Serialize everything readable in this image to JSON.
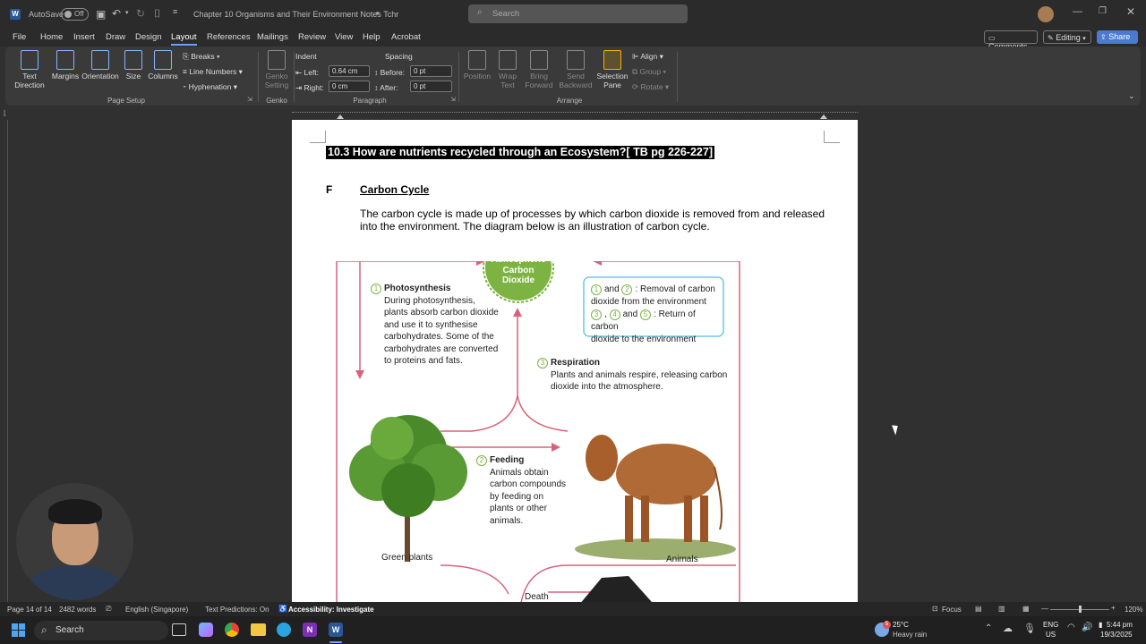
{
  "window": {
    "app_icon": "W",
    "autosave_label": "AutoSave",
    "autosave_state": "Off",
    "doc_title": "Chapter 10 Organisms and Their Environment Notes Tchr",
    "search_placeholder": "Search"
  },
  "menu_tabs": [
    "File",
    "Home",
    "Insert",
    "Draw",
    "Design",
    "Layout",
    "References",
    "Mailings",
    "Review",
    "View",
    "Help",
    "Acrobat"
  ],
  "active_tab": "Layout",
  "top_right": {
    "comments": "Comments",
    "editing": "Editing",
    "share": "Share"
  },
  "ribbon": {
    "page_setup": {
      "text_direction": "Text Direction",
      "margins": "Margins",
      "orientation": "Orientation",
      "size": "Size",
      "columns": "Columns",
      "breaks": "Breaks",
      "line_numbers": "Line Numbers",
      "hyphenation": "Hyphenation",
      "group_label": "Page Setup"
    },
    "genko": {
      "button": "Genko Setting",
      "group_label": "Genko"
    },
    "paragraph": {
      "indent_label": "Indent",
      "spacing_label": "Spacing",
      "left_label": "Left:",
      "left_value": "0.64 cm",
      "right_label": "Right:",
      "right_value": "0 cm",
      "before_label": "Before:",
      "before_value": "0 pt",
      "after_label": "After:",
      "after_value": "0 pt",
      "group_label": "Paragraph"
    },
    "arrange": {
      "position": "Position",
      "wrap_text": "Wrap Text",
      "bring_forward": "Bring Forward",
      "send_backward": "Send Backward",
      "selection_pane": "Selection Pane",
      "align": "Align",
      "group": "Group",
      "rotate": "Rotate",
      "group_label": "Arrange"
    }
  },
  "document": {
    "heading": "10.3 How are nutrients recycled through an Ecosystem?[ TB pg 226-227]",
    "section_letter": "F",
    "section_title": "Carbon Cycle",
    "intro": "The carbon cycle is made up of processes by which carbon dioxide is removed from and released into the environment. The diagram below is an illustration of carbon cycle.",
    "diagram": {
      "atmo_line1": "Atmospheric",
      "atmo_line2": "Carbon",
      "atmo_line3": "Dioxide",
      "photo_num": "1",
      "photo_title": "Photosynthesis",
      "photo_lines": [
        "During photosynthesis,",
        "plants absorb carbon dioxide",
        "and use it to synthesise",
        "carbohydrates. Some of the",
        "carbohydrates are converted",
        "to proteins and fats."
      ],
      "legend_line1": ": Removal of carbon",
      "legend_line2": "dioxide from the environment",
      "legend_line3": ": Return of carbon",
      "legend_line4": "dioxide to the environment",
      "legend_and": "and",
      "legend_comma": ",",
      "legend_nums": [
        "1",
        "2",
        "3",
        "4",
        "5"
      ],
      "resp_num": "3",
      "resp_title": "Respiration",
      "resp_lines": [
        "Plants and animals respire, releasing carbon",
        "dioxide into the atmosphere."
      ],
      "feed_num": "2",
      "feed_title": "Feeding",
      "feed_lines": [
        "Animals obtain",
        "carbon compounds",
        "by feeding on",
        "plants or other",
        "animals."
      ],
      "green_plants": "Green plants",
      "animals": "Animals",
      "death": "Death"
    }
  },
  "status": {
    "page": "Page 14 of 14",
    "words": "2482 words",
    "language": "English (Singapore)",
    "predictions": "Text Predictions: On",
    "accessibility": "Accessibility: Investigate",
    "focus": "Focus",
    "zoom": "120%"
  },
  "taskbar": {
    "search": "Search",
    "weather_temp": "25°C",
    "weather_desc": "Heavy rain",
    "lang1": "ENG",
    "lang2": "US",
    "time": "5:44 pm",
    "date": "19/3/2025",
    "weather_badge": "5"
  }
}
